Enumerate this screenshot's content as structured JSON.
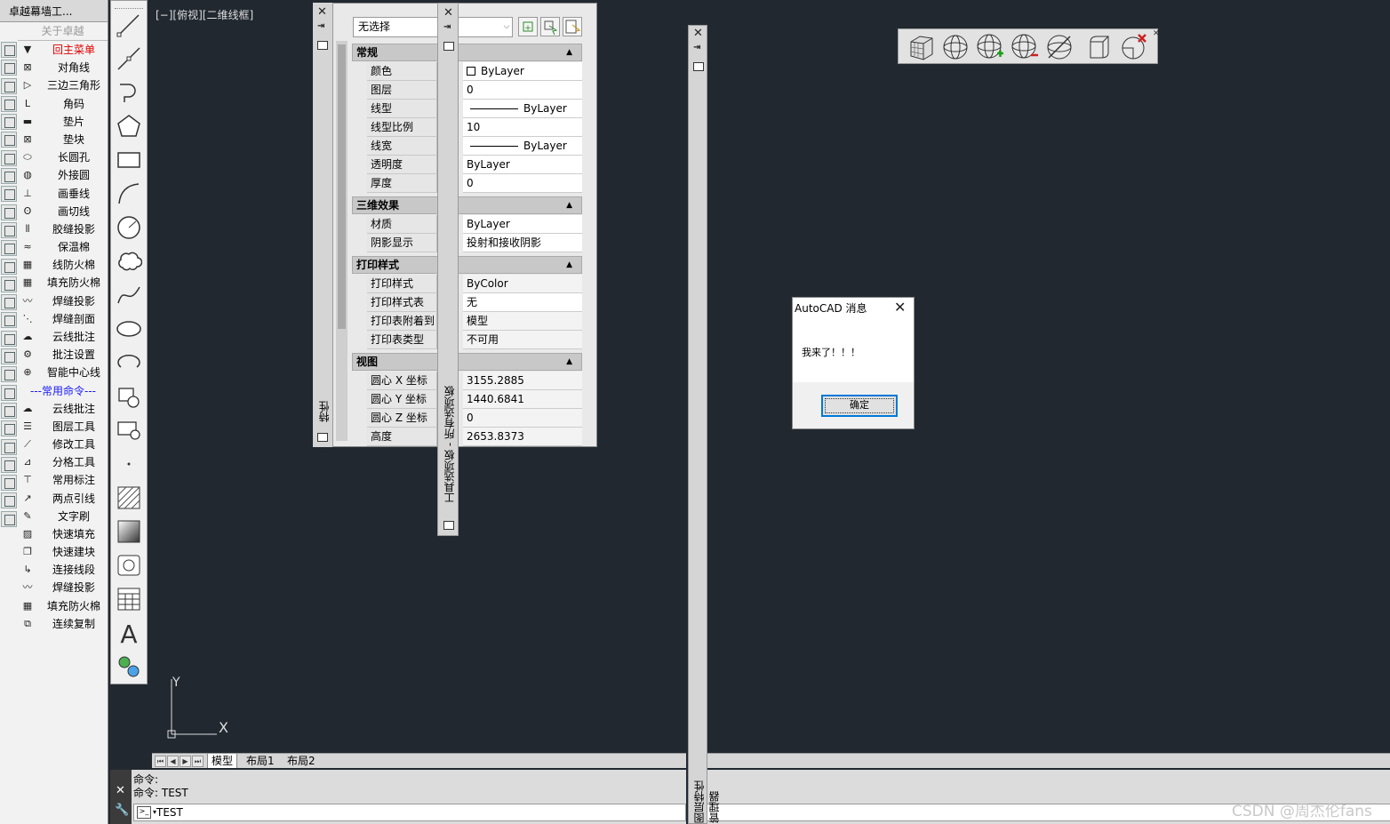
{
  "left_menu": {
    "title": "卓越幕墙工...",
    "about": "关于卓越",
    "items": [
      {
        "label": "回主菜单",
        "icon": "▼",
        "red": true
      },
      {
        "label": "对角线",
        "icon": "⊠"
      },
      {
        "label": "三边三角形",
        "icon": "▷"
      },
      {
        "label": "角码",
        "icon": "L"
      },
      {
        "label": "垫片",
        "icon": "▬"
      },
      {
        "label": "垫块",
        "icon": "⊠"
      },
      {
        "label": "长圆孔",
        "icon": "⬭"
      },
      {
        "label": "外接圆",
        "icon": "◍"
      },
      {
        "label": "画垂线",
        "icon": "⊥"
      },
      {
        "label": "画切线",
        "icon": "ʘ"
      },
      {
        "label": "胶缝投影",
        "icon": "⦀"
      },
      {
        "label": "保温棉",
        "icon": "≈"
      },
      {
        "label": "线防火棉",
        "icon": "▦"
      },
      {
        "label": "填充防火棉",
        "icon": "▦"
      },
      {
        "label": "焊缝投影",
        "icon": "〰"
      },
      {
        "label": "焊缝剖面",
        "icon": "⋱"
      },
      {
        "label": "云线批注",
        "icon": "☁"
      },
      {
        "label": "批注设置",
        "icon": "⚙"
      },
      {
        "label": "智能中心线",
        "icon": "⊕"
      }
    ],
    "separator": "---常用命令---",
    "items2": [
      {
        "label": "云线批注",
        "icon": "☁"
      },
      {
        "label": "图层工具",
        "icon": "☰"
      },
      {
        "label": "修改工具",
        "icon": "⟋"
      },
      {
        "label": "分格工具",
        "icon": "⊿"
      },
      {
        "label": "常用标注",
        "icon": "⊤"
      },
      {
        "label": "两点引线",
        "icon": "↗"
      },
      {
        "label": "文字刷",
        "icon": "✎"
      },
      {
        "label": "快速填充",
        "icon": "▨"
      },
      {
        "label": "快速建块",
        "icon": "❐"
      },
      {
        "label": "连接线段",
        "icon": "↳"
      },
      {
        "label": "焊缝投影",
        "icon": "〰"
      },
      {
        "label": "填充防火棉",
        "icon": "▦"
      },
      {
        "label": "连续复制",
        "icon": "⧉"
      }
    ]
  },
  "viewport": {
    "label": "[−][俯视][二维线框]",
    "ucs_y": "Y",
    "ucs_x": "X"
  },
  "layout_tabs": [
    "模型",
    "布局1",
    "布局2"
  ],
  "command": {
    "history": [
      "命令:",
      "命令: TEST"
    ],
    "input": "TEST"
  },
  "properties": {
    "selection": "无选择",
    "side_title": "特性",
    "sections": [
      {
        "title": "常规",
        "rows": [
          {
            "key": "颜色",
            "value": "ByLayer",
            "swatch": true
          },
          {
            "key": "图层",
            "value": "0"
          },
          {
            "key": "线型",
            "value": "ByLayer",
            "line": true
          },
          {
            "key": "线型比例",
            "value": "10"
          },
          {
            "key": "线宽",
            "value": "ByLayer",
            "line": true
          },
          {
            "key": "透明度",
            "value": "ByLayer"
          },
          {
            "key": "厚度",
            "value": "0"
          }
        ]
      },
      {
        "title": "三维效果",
        "rows": [
          {
            "key": "材质",
            "value": "ByLayer"
          },
          {
            "key": "阴影显示",
            "value": "投射和接收阴影"
          }
        ]
      },
      {
        "title": "打印样式",
        "rows": [
          {
            "key": "打印样式",
            "value": "ByColor",
            "gray": true
          },
          {
            "key": "打印样式表",
            "value": "无"
          },
          {
            "key": "打印表附着到",
            "value": "模型",
            "gray": true
          },
          {
            "key": "打印表类型",
            "value": "不可用",
            "gray": true
          }
        ]
      },
      {
        "title": "视图",
        "rows": [
          {
            "key": "圆心 X 坐标",
            "value": "3155.2885",
            "gray": true
          },
          {
            "key": "圆心 Y 坐标",
            "value": "1440.6841",
            "gray": true
          },
          {
            "key": "圆心 Z 坐标",
            "value": "0",
            "gray": true
          },
          {
            "key": "高度",
            "value": "2653.8373",
            "gray": true
          }
        ]
      }
    ]
  },
  "tool_palettes": {
    "title": "工具选项板 - 所有选项板"
  },
  "layer_manager": {
    "title": "图层特性管理器"
  },
  "dialog": {
    "title": "AutoCAD 消息",
    "message": "我来了！！！",
    "ok": "确定"
  },
  "watermark": "CSDN @周杰伦fans",
  "colors": {
    "canvas": "#212830",
    "panel": "#e9e9e9",
    "accent": "#0078d7",
    "menu_red": "#e00000",
    "separator_blue": "#1a1aff"
  }
}
